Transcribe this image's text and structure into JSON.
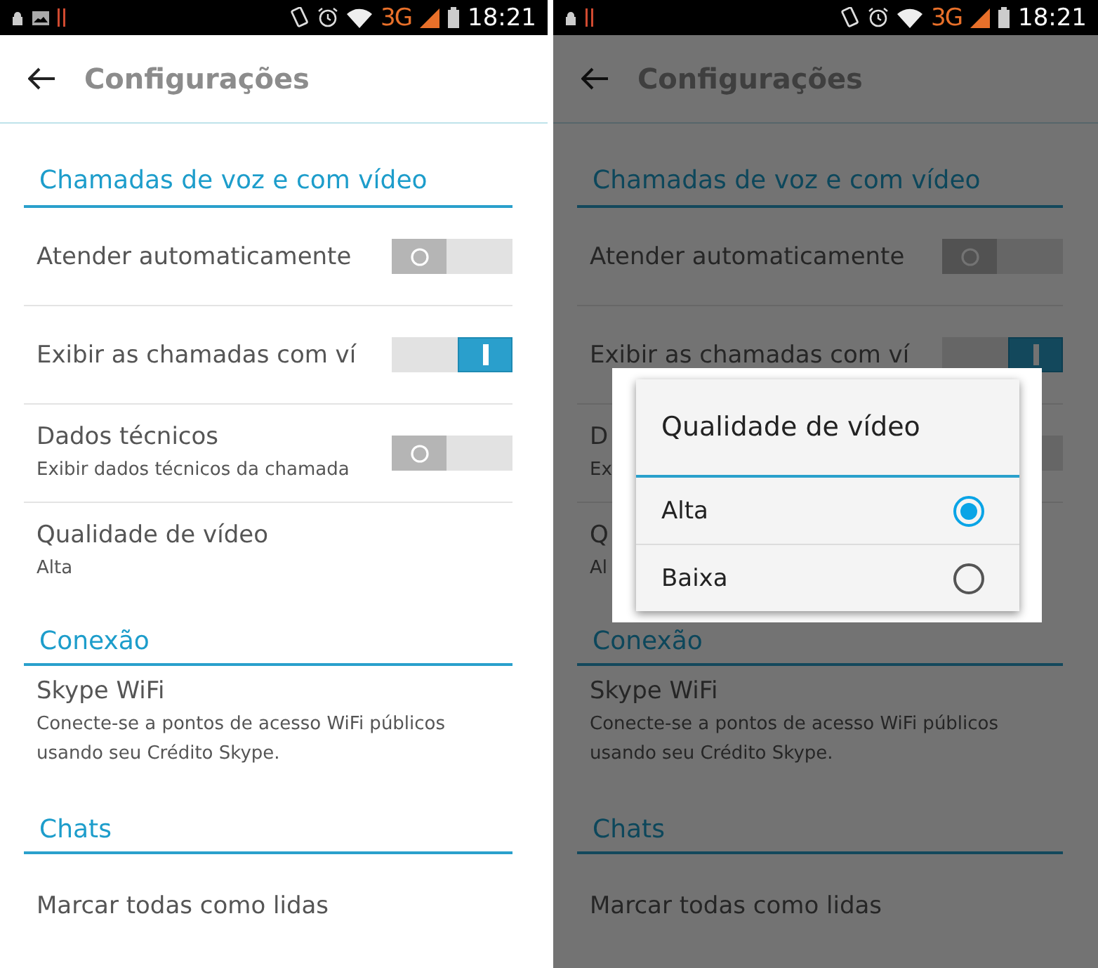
{
  "screens": [
    {
      "status_bar": {
        "notification_icons": [
          {
            "kind": "lock"
          },
          {
            "kind": "image"
          },
          {
            "kind": "pause"
          }
        ],
        "network": "3G",
        "time": "18:21"
      },
      "app_bar": {
        "title": "Configurações"
      },
      "sections": [
        {
          "title": "Chamadas de voz e com vídeo",
          "items": [
            {
              "kind": "toggle",
              "label": "Atender automaticamente",
              "on": false
            },
            {
              "kind": "toggle",
              "label": "Exibir as chamadas com ví",
              "on": true
            },
            {
              "kind": "toggle",
              "label": "Dados técnicos",
              "subtitle": "Exibir dados técnicos da chamada",
              "on": false
            },
            {
              "kind": "value",
              "label": "Qualidade de vídeo",
              "subtitle": "Alta"
            }
          ]
        },
        {
          "title": "Conexão",
          "items": [
            {
              "kind": "text",
              "label": "Skype WiFi",
              "subtitle": "Conecte-se a pontos de acesso WiFi públicos usando seu Crédito Skype."
            }
          ]
        },
        {
          "title": "Chats",
          "items": [
            {
              "kind": "plain",
              "label": "Marcar todas como lidas"
            }
          ]
        }
      ]
    },
    {
      "status_bar": {
        "notification_icons": [
          {
            "kind": "lock"
          },
          {
            "kind": "pause"
          }
        ],
        "network": "3G",
        "time": "18:21"
      },
      "app_bar": {
        "title": "Configurações"
      },
      "sections": [
        {
          "title": "Chamadas de voz e com vídeo",
          "items": [
            {
              "kind": "toggle",
              "label": "Atender automaticamente",
              "on": false
            },
            {
              "kind": "toggle",
              "label": "Exibir as chamadas com ví",
              "on": true
            },
            {
              "kind": "covered_toggle",
              "label": "D",
              "subtitle": "Ex"
            },
            {
              "kind": "value",
              "label": "Q",
              "subtitle": "Al"
            }
          ]
        },
        {
          "title": "Conexão",
          "items": [
            {
              "kind": "text",
              "label": "Skype WiFi",
              "subtitle": "Conecte-se a pontos de acesso WiFi públicos usando seu Crédito Skype."
            }
          ]
        },
        {
          "title": "Chats",
          "items": [
            {
              "kind": "plain",
              "label": "Marcar todas como lidas"
            }
          ]
        }
      ],
      "dialog": {
        "title": "Qualidade de vídeo",
        "options": [
          {
            "label": "Alta",
            "selected": true
          },
          {
            "label": "Baixa",
            "selected": false
          }
        ]
      }
    }
  ]
}
